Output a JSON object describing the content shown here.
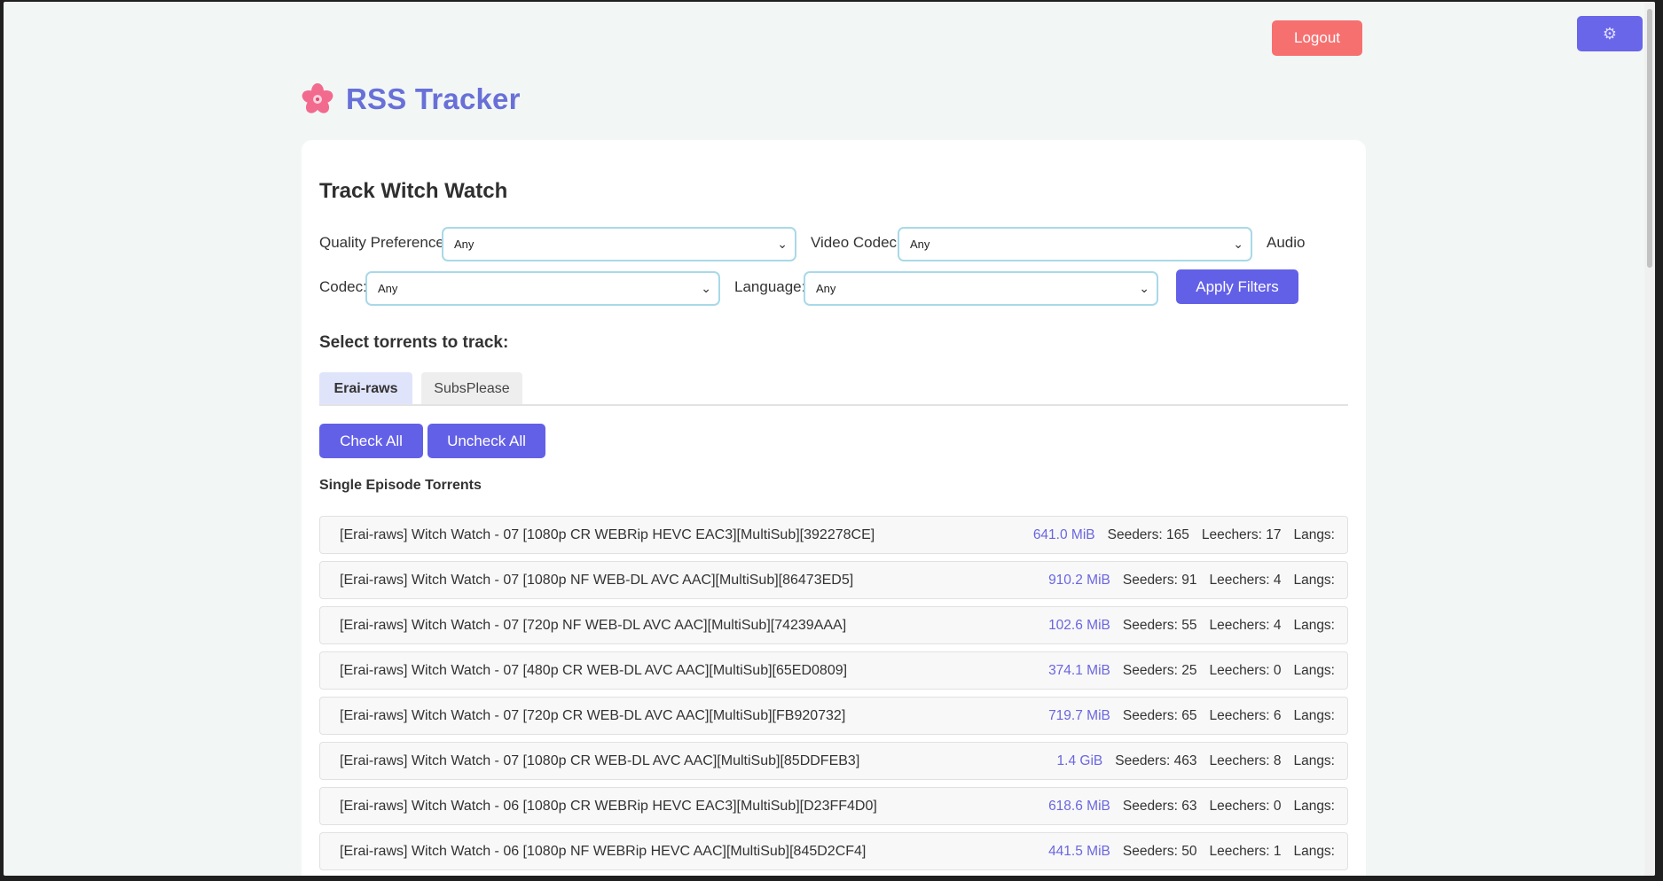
{
  "header": {
    "logout_label": "Logout",
    "settings_icon": "gear-icon"
  },
  "brand": {
    "title": "RSS Tracker",
    "icon": "sakura-flower-icon"
  },
  "card": {
    "title": "Track Witch Watch"
  },
  "filters": {
    "quality_label": "Quality Preference:",
    "quality_value": "Any",
    "video_label": "Video Codec:",
    "video_value": "Any",
    "audio_label_part1": "Audio",
    "audio_label_part2": "Codec:",
    "audio_value": "Any",
    "language_label": "Language:",
    "language_value": "Any",
    "apply_label": "Apply Filters"
  },
  "select_title": "Select torrents to track:",
  "tabs": [
    {
      "label": "Erai-raws",
      "active": true
    },
    {
      "label": "SubsPlease",
      "active": false
    }
  ],
  "actions": {
    "check_all": "Check All",
    "uncheck_all": "Uncheck All"
  },
  "list_title": "Single Episode Torrents",
  "torrents": [
    {
      "name": "[Erai-raws] Witch Watch - 07 [1080p CR WEBRip HEVC EAC3][MultiSub][392278CE]",
      "size": "641.0 MiB",
      "seeders": "Seeders: 165",
      "leechers": "Leechers: 17",
      "langs": "Langs:"
    },
    {
      "name": "[Erai-raws] Witch Watch - 07 [1080p NF WEB-DL AVC AAC][MultiSub][86473ED5]",
      "size": "910.2 MiB",
      "seeders": "Seeders: 91",
      "leechers": "Leechers: 4",
      "langs": "Langs:"
    },
    {
      "name": "[Erai-raws] Witch Watch - 07 [720p NF WEB-DL AVC AAC][MultiSub][74239AAA]",
      "size": "102.6 MiB",
      "seeders": "Seeders: 55",
      "leechers": "Leechers: 4",
      "langs": "Langs:"
    },
    {
      "name": "[Erai-raws] Witch Watch - 07 [480p CR WEB-DL AVC AAC][MultiSub][65ED0809]",
      "size": "374.1 MiB",
      "seeders": "Seeders: 25",
      "leechers": "Leechers: 0",
      "langs": "Langs:"
    },
    {
      "name": "[Erai-raws] Witch Watch - 07 [720p CR WEB-DL AVC AAC][MultiSub][FB920732]",
      "size": "719.7 MiB",
      "seeders": "Seeders: 65",
      "leechers": "Leechers: 6",
      "langs": "Langs:"
    },
    {
      "name": "[Erai-raws] Witch Watch - 07 [1080p CR WEB-DL AVC AAC][MultiSub][85DDFEB3]",
      "size": "1.4 GiB",
      "seeders": "Seeders: 463",
      "leechers": "Leechers: 8",
      "langs": "Langs:"
    },
    {
      "name": "[Erai-raws] Witch Watch - 06 [1080p CR WEBRip HEVC EAC3][MultiSub][D23FF4D0]",
      "size": "618.6 MiB",
      "seeders": "Seeders: 63",
      "leechers": "Leechers: 0",
      "langs": "Langs:"
    },
    {
      "name": "[Erai-raws] Witch Watch - 06 [1080p NF WEBRip HEVC AAC][MultiSub][845D2CF4]",
      "size": "441.5 MiB",
      "seeders": "Seeders: 50",
      "leechers": "Leechers: 1",
      "langs": "Langs:"
    }
  ]
}
